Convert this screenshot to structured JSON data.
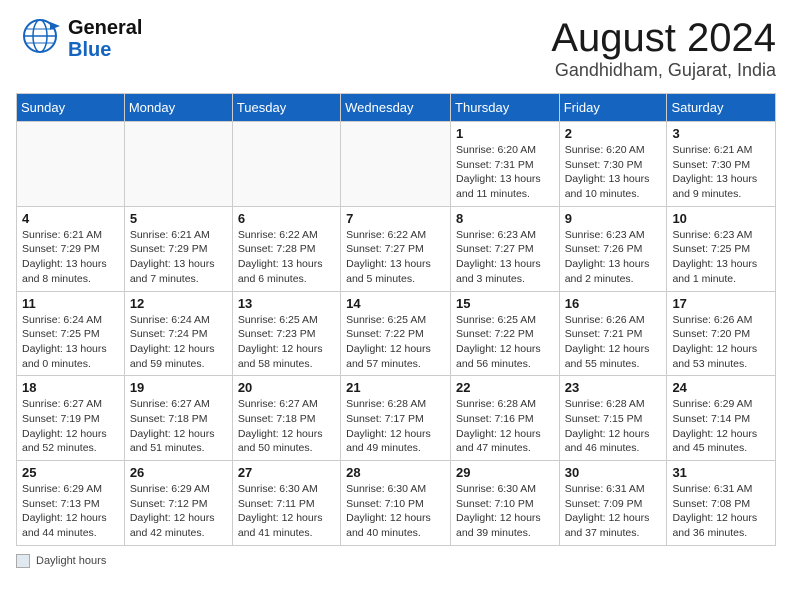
{
  "header": {
    "logo_general": "General",
    "logo_blue": "Blue",
    "month_year": "August 2024",
    "location": "Gandhidham, Gujarat, India"
  },
  "calendar": {
    "days_of_week": [
      "Sunday",
      "Monday",
      "Tuesday",
      "Wednesday",
      "Thursday",
      "Friday",
      "Saturday"
    ],
    "weeks": [
      [
        {
          "day": "",
          "info": ""
        },
        {
          "day": "",
          "info": ""
        },
        {
          "day": "",
          "info": ""
        },
        {
          "day": "",
          "info": ""
        },
        {
          "day": "1",
          "info": "Sunrise: 6:20 AM\nSunset: 7:31 PM\nDaylight: 13 hours and 11 minutes."
        },
        {
          "day": "2",
          "info": "Sunrise: 6:20 AM\nSunset: 7:30 PM\nDaylight: 13 hours and 10 minutes."
        },
        {
          "day": "3",
          "info": "Sunrise: 6:21 AM\nSunset: 7:30 PM\nDaylight: 13 hours and 9 minutes."
        }
      ],
      [
        {
          "day": "4",
          "info": "Sunrise: 6:21 AM\nSunset: 7:29 PM\nDaylight: 13 hours and 8 minutes."
        },
        {
          "day": "5",
          "info": "Sunrise: 6:21 AM\nSunset: 7:29 PM\nDaylight: 13 hours and 7 minutes."
        },
        {
          "day": "6",
          "info": "Sunrise: 6:22 AM\nSunset: 7:28 PM\nDaylight: 13 hours and 6 minutes."
        },
        {
          "day": "7",
          "info": "Sunrise: 6:22 AM\nSunset: 7:27 PM\nDaylight: 13 hours and 5 minutes."
        },
        {
          "day": "8",
          "info": "Sunrise: 6:23 AM\nSunset: 7:27 PM\nDaylight: 13 hours and 3 minutes."
        },
        {
          "day": "9",
          "info": "Sunrise: 6:23 AM\nSunset: 7:26 PM\nDaylight: 13 hours and 2 minutes."
        },
        {
          "day": "10",
          "info": "Sunrise: 6:23 AM\nSunset: 7:25 PM\nDaylight: 13 hours and 1 minute."
        }
      ],
      [
        {
          "day": "11",
          "info": "Sunrise: 6:24 AM\nSunset: 7:25 PM\nDaylight: 13 hours and 0 minutes."
        },
        {
          "day": "12",
          "info": "Sunrise: 6:24 AM\nSunset: 7:24 PM\nDaylight: 12 hours and 59 minutes."
        },
        {
          "day": "13",
          "info": "Sunrise: 6:25 AM\nSunset: 7:23 PM\nDaylight: 12 hours and 58 minutes."
        },
        {
          "day": "14",
          "info": "Sunrise: 6:25 AM\nSunset: 7:22 PM\nDaylight: 12 hours and 57 minutes."
        },
        {
          "day": "15",
          "info": "Sunrise: 6:25 AM\nSunset: 7:22 PM\nDaylight: 12 hours and 56 minutes."
        },
        {
          "day": "16",
          "info": "Sunrise: 6:26 AM\nSunset: 7:21 PM\nDaylight: 12 hours and 55 minutes."
        },
        {
          "day": "17",
          "info": "Sunrise: 6:26 AM\nSunset: 7:20 PM\nDaylight: 12 hours and 53 minutes."
        }
      ],
      [
        {
          "day": "18",
          "info": "Sunrise: 6:27 AM\nSunset: 7:19 PM\nDaylight: 12 hours and 52 minutes."
        },
        {
          "day": "19",
          "info": "Sunrise: 6:27 AM\nSunset: 7:18 PM\nDaylight: 12 hours and 51 minutes."
        },
        {
          "day": "20",
          "info": "Sunrise: 6:27 AM\nSunset: 7:18 PM\nDaylight: 12 hours and 50 minutes."
        },
        {
          "day": "21",
          "info": "Sunrise: 6:28 AM\nSunset: 7:17 PM\nDaylight: 12 hours and 49 minutes."
        },
        {
          "day": "22",
          "info": "Sunrise: 6:28 AM\nSunset: 7:16 PM\nDaylight: 12 hours and 47 minutes."
        },
        {
          "day": "23",
          "info": "Sunrise: 6:28 AM\nSunset: 7:15 PM\nDaylight: 12 hours and 46 minutes."
        },
        {
          "day": "24",
          "info": "Sunrise: 6:29 AM\nSunset: 7:14 PM\nDaylight: 12 hours and 45 minutes."
        }
      ],
      [
        {
          "day": "25",
          "info": "Sunrise: 6:29 AM\nSunset: 7:13 PM\nDaylight: 12 hours and 44 minutes."
        },
        {
          "day": "26",
          "info": "Sunrise: 6:29 AM\nSunset: 7:12 PM\nDaylight: 12 hours and 42 minutes."
        },
        {
          "day": "27",
          "info": "Sunrise: 6:30 AM\nSunset: 7:11 PM\nDaylight: 12 hours and 41 minutes."
        },
        {
          "day": "28",
          "info": "Sunrise: 6:30 AM\nSunset: 7:10 PM\nDaylight: 12 hours and 40 minutes."
        },
        {
          "day": "29",
          "info": "Sunrise: 6:30 AM\nSunset: 7:10 PM\nDaylight: 12 hours and 39 minutes."
        },
        {
          "day": "30",
          "info": "Sunrise: 6:31 AM\nSunset: 7:09 PM\nDaylight: 12 hours and 37 minutes."
        },
        {
          "day": "31",
          "info": "Sunrise: 6:31 AM\nSunset: 7:08 PM\nDaylight: 12 hours and 36 minutes."
        }
      ]
    ]
  },
  "footer": {
    "daylight_label": "Daylight hours"
  }
}
